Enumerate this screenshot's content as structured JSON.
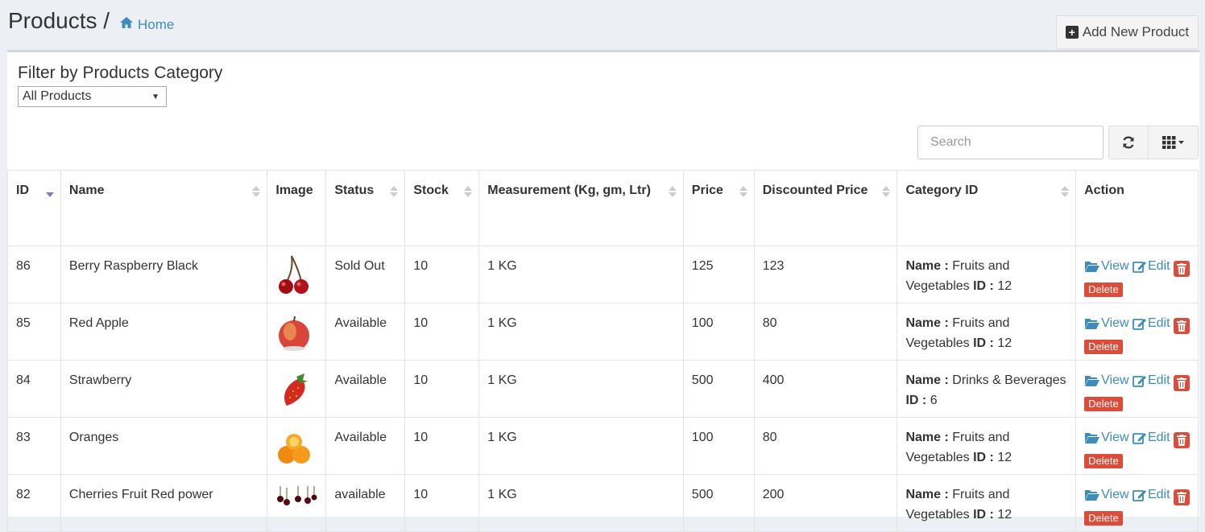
{
  "header": {
    "title": "Products /",
    "breadcrumb_home": "Home",
    "add_button": "Add New Product"
  },
  "filter": {
    "title": "Filter by Products Category",
    "selected": "All Products"
  },
  "toolbar": {
    "search_placeholder": "Search"
  },
  "table": {
    "columns": [
      "ID",
      "Name",
      "Image",
      "Status",
      "Stock",
      "Measurement (Kg, gm, Ltr)",
      "Price",
      "Discounted Price",
      "Category ID",
      "Action"
    ],
    "rows": [
      {
        "id": "86",
        "name": "Berry Raspberry Black",
        "image": "cherry-image",
        "status": "Sold Out",
        "stock": "10",
        "measurement": "1 KG",
        "price": "125",
        "discounted": "123",
        "cat_name": "Fruits and Vegetables",
        "cat_id": "12"
      },
      {
        "id": "85",
        "name": "Red Apple",
        "image": "apple-image",
        "status": "Available",
        "stock": "10",
        "measurement": "1 KG",
        "price": "100",
        "discounted": "80",
        "cat_name": "Fruits and Vegetables",
        "cat_id": "12"
      },
      {
        "id": "84",
        "name": "Strawberry",
        "image": "strawberry-image",
        "status": "Available",
        "stock": "10",
        "measurement": "1 KG",
        "price": "500",
        "discounted": "400",
        "cat_name": "Drinks & Beverages",
        "cat_id": "6"
      },
      {
        "id": "83",
        "name": "Oranges",
        "image": "orange-image",
        "status": "Available",
        "stock": "10",
        "measurement": "1 KG",
        "price": "100",
        "discounted": "80",
        "cat_name": "Fruits and Vegetables",
        "cat_id": "12"
      },
      {
        "id": "82",
        "name": "Cherries Fruit Red power",
        "image": "cherries-image",
        "status": "available",
        "stock": "10",
        "measurement": "1 KG",
        "price": "500",
        "discounted": "200",
        "cat_name": "Fruits and Vegetables",
        "cat_id": "12"
      }
    ],
    "labels": {
      "name_prefix": "Name :",
      "id_prefix": "ID :",
      "view": "View",
      "edit": "Edit",
      "delete": "Delete"
    }
  },
  "colors": {
    "link": "#3c8dbc",
    "danger": "#dd4b39",
    "background": "#ecf0f5"
  }
}
